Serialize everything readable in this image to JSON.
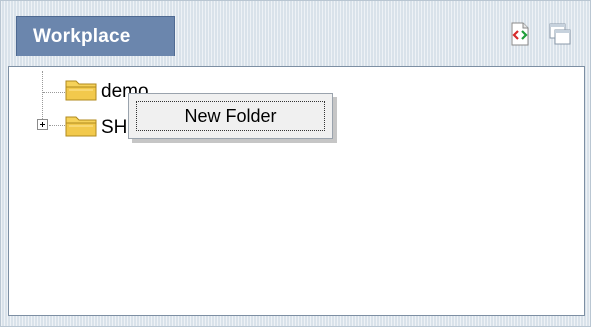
{
  "header": {
    "tab_label": "Workplace",
    "icons": [
      "source-code-icon",
      "windows-icon"
    ]
  },
  "tree": {
    "items": [
      {
        "label": "demo",
        "icon": "folder-icon",
        "expandable": false
      },
      {
        "label": "SH",
        "icon": "folder-icon",
        "expandable": true
      }
    ]
  },
  "context_menu": {
    "items": [
      {
        "label": "New Folder"
      }
    ]
  },
  "colors": {
    "tab_bg": "#6b86ad",
    "folder": "#f2c94c",
    "panel_border": "#7d8fa3"
  }
}
